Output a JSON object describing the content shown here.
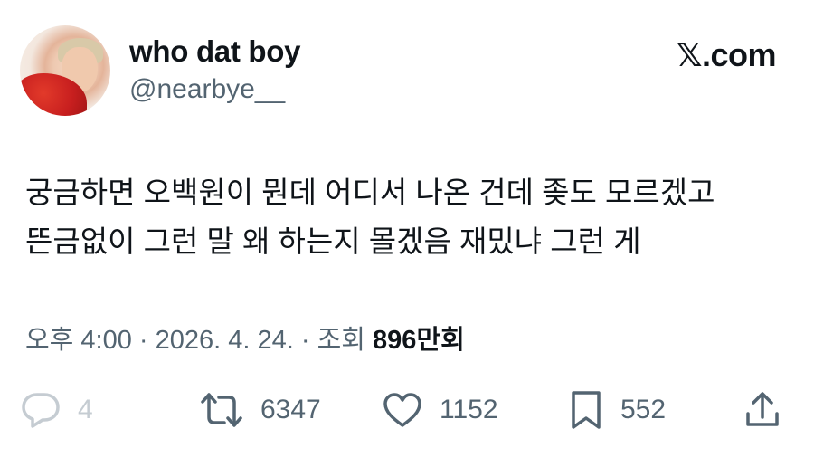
{
  "author": {
    "display_name": "who dat boy",
    "handle": "@nearbye__"
  },
  "brand": "𝕏.com",
  "tweet": {
    "lines": [
      "궁금하면 오백원이 뭔데 어디서 나온 건데 좆도 모르겠고",
      "뜬금없이 그런 말 왜 하는지 몰겠음 재밌냐 그런 게"
    ]
  },
  "meta": {
    "time": "오후 4:00",
    "separator": " · ",
    "date": "2026. 4. 24.",
    "views_label": "조회 ",
    "views_count": "896",
    "views_unit": "만회"
  },
  "actions": {
    "reply_count": "4",
    "retweet_count": "6347",
    "like_count": "1152",
    "bookmark_count": "552"
  },
  "icons": {
    "reply": "speech-bubble-icon",
    "retweet": "retweet-icon",
    "like": "heart-icon",
    "bookmark": "bookmark-icon",
    "share": "share-upload-icon"
  },
  "colors": {
    "text": "#0f1419",
    "secondary": "#536471",
    "muted": "#c5ccd2",
    "background": "#ffffff"
  }
}
